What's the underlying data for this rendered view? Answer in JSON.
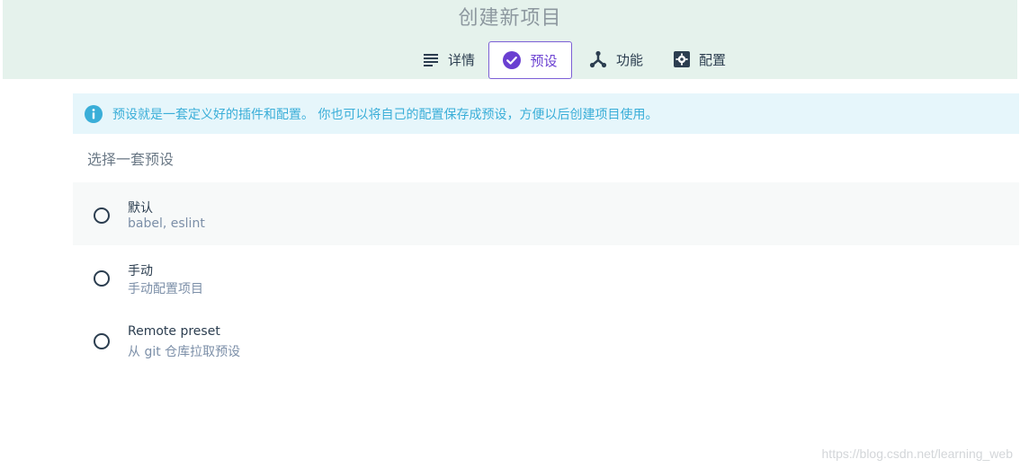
{
  "header": {
    "title": "创建新项目",
    "tabs": [
      {
        "label": "详情",
        "icon": "list-icon"
      },
      {
        "label": "预设",
        "icon": "check-circle-icon",
        "selected": true
      },
      {
        "label": "功能",
        "icon": "fork-icon"
      },
      {
        "label": "配置",
        "icon": "settings-icon"
      }
    ]
  },
  "info": {
    "text": "预设就是一套定义好的插件和配置。 你也可以将自己的配置保存成预设，方便以后创建项目使用。",
    "icon": "info-icon"
  },
  "section_title": "选择一套预设",
  "presets": [
    {
      "name": "默认",
      "desc": "babel, eslint"
    },
    {
      "name": "手动",
      "desc": "手动配置项目"
    },
    {
      "name": "Remote preset",
      "desc": "从 git 仓库拉取预设"
    }
  ],
  "watermark": "https://blog.csdn.net/learning_web",
  "colors": {
    "accent": "#6a3fd1",
    "header_bg": "#e5f2ec",
    "info_bg": "#e6f6fb",
    "info_text": "#3aaed8"
  }
}
